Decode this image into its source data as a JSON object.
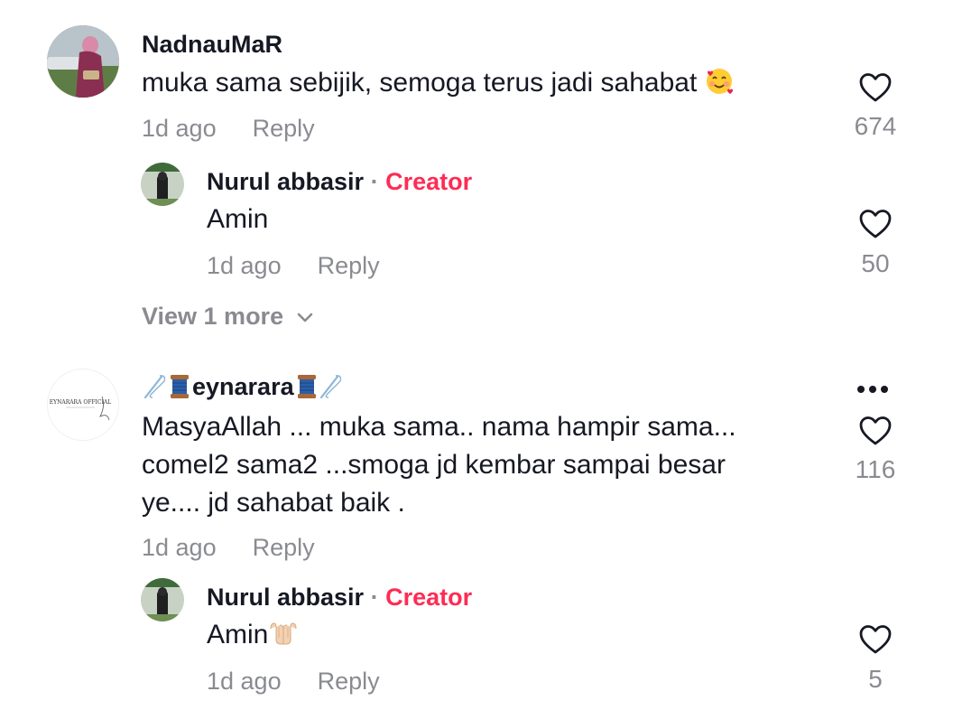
{
  "comments": [
    {
      "username": "NadnauMaR",
      "text": "muka sama sebijik, semoga terus jadi sahabat",
      "time": "1d ago",
      "reply_label": "Reply",
      "likes": "674",
      "replies": [
        {
          "username": "Nurul abbasir",
          "separator": "·",
          "badge": "Creator",
          "text": "Amin",
          "time": "1d ago",
          "reply_label": "Reply",
          "likes": "50"
        }
      ],
      "view_more": "View 1 more"
    },
    {
      "username": "eynarara",
      "avatar_text": "EYNARARA OFFICIAL",
      "text_lines": [
        "MasyaAllah ... muka sama.. nama hampir sama...",
        "comel2 sama2 ...smoga jd kembar sampai besar",
        "ye.... jd sahabat baik ."
      ],
      "time": "1d ago",
      "reply_label": "Reply",
      "likes": "116",
      "replies": [
        {
          "username": "Nurul abbasir",
          "separator": "·",
          "badge": "Creator",
          "text": "Amin",
          "time": "1d ago",
          "reply_label": "Reply",
          "likes": "5"
        }
      ]
    }
  ],
  "icons": {
    "like": "heart-outline-icon",
    "more": "more-horizontal-icon",
    "expand": "chevron-down-icon"
  },
  "colors": {
    "creator_badge": "#fe2c55",
    "secondary_text": "#8a8b91",
    "primary_text": "#161823"
  }
}
